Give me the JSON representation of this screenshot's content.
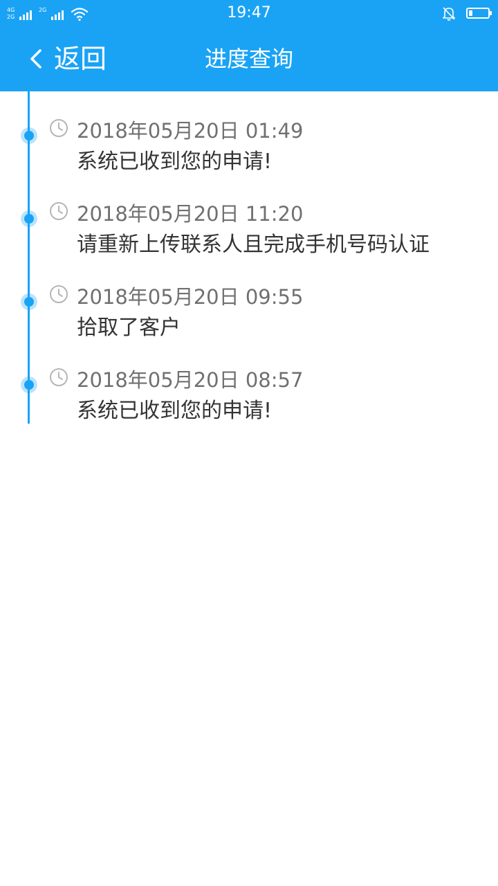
{
  "status_bar": {
    "network_1": "4G",
    "network_2": "2G",
    "network_3": "2G",
    "time": "19:47",
    "icons": [
      "signal-icon",
      "wifi-icon",
      "bell-off-icon",
      "battery-icon"
    ],
    "battery_level": 0.2
  },
  "header": {
    "back_label": "返回",
    "title": "进度查询",
    "background_color": "#1aa3f5"
  },
  "timeline": {
    "accent_color": "#1aa3f5",
    "items": [
      {
        "time": "2018年05月20日 01:49",
        "text": "系统已收到您的申请!"
      },
      {
        "time": "2018年05月20日 11:20",
        "text": "请重新上传联系人且完成手机号码认证"
      },
      {
        "time": "2018年05月20日 09:55",
        "text": "拾取了客户"
      },
      {
        "time": "2018年05月20日 08:57",
        "text": "系统已收到您的申请!"
      }
    ]
  }
}
